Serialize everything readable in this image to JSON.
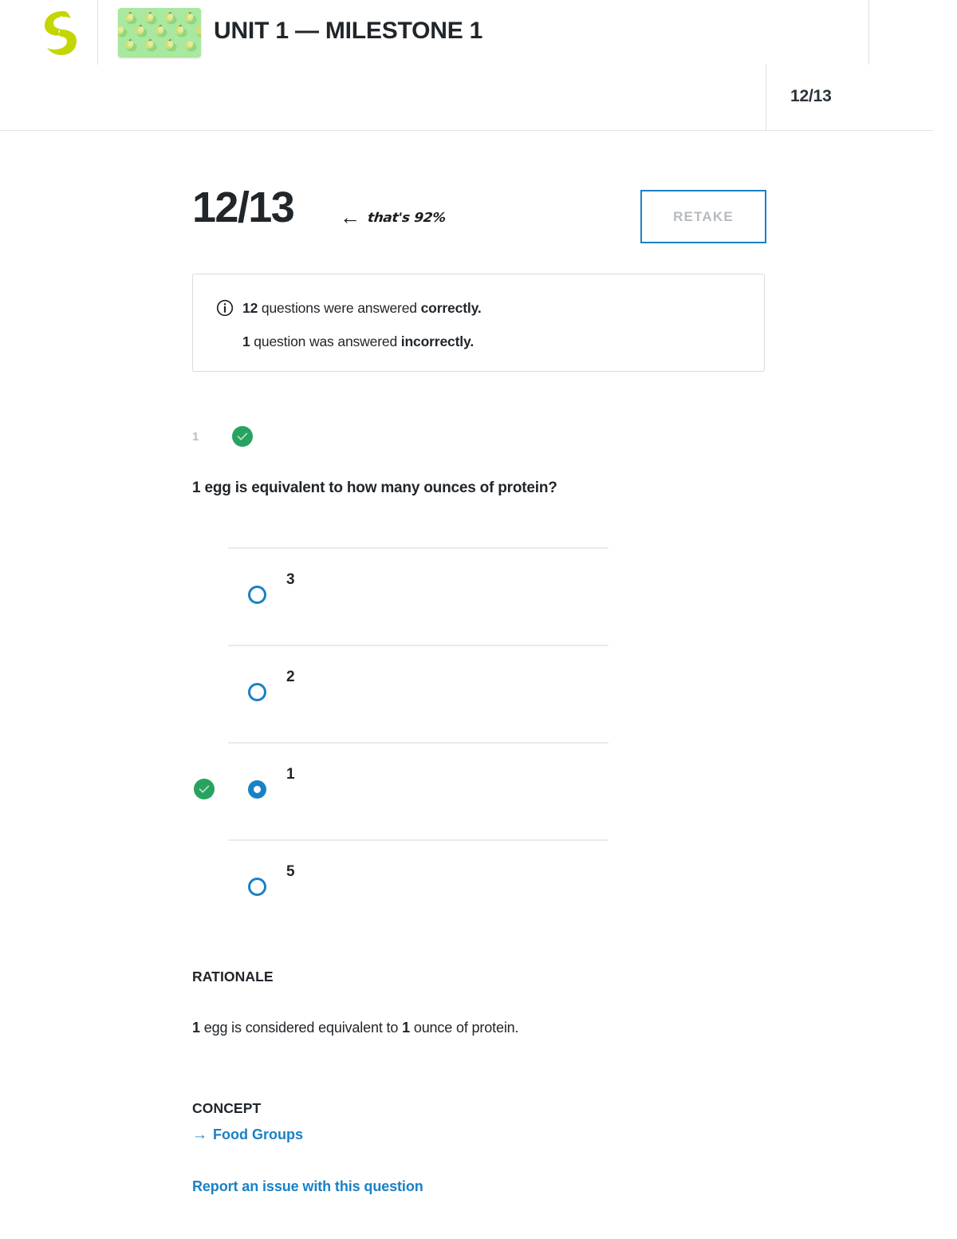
{
  "header": {
    "logo_icon": "sophia-leaf-logo",
    "thumbnail_icon": "green-apples-pattern-thumbnail",
    "title": "UNIT 1 — MILESTONE 1",
    "score": "12/13"
  },
  "score_section": {
    "score": "12/13",
    "annotation_arrow": "←",
    "annotation_text": "that's 92%",
    "retake_label": "RETAKE"
  },
  "info_box": {
    "icon": "info-circle-icon",
    "line1_count": "12",
    "line1_text": " questions were answered ",
    "line1_emphasis": "correctly",
    "line1_end": ".",
    "line2_count": "1",
    "line2_text": " question was answered ",
    "line2_emphasis": "incorrectly",
    "line2_end": "."
  },
  "question": {
    "number": "1",
    "status_icon": "green-check-circle",
    "text": "1 egg is equivalent to how many ounces of protein?",
    "options": [
      {
        "label": "3",
        "selected": false,
        "correct": false
      },
      {
        "label": "2",
        "selected": false,
        "correct": false
      },
      {
        "label": "1",
        "selected": true,
        "correct": true
      },
      {
        "label": "5",
        "selected": false,
        "correct": false
      }
    ],
    "rationale_heading": "RATIONALE",
    "rationale_lead": "1",
    "rationale_mid": " egg is considered equivalent to ",
    "rationale_num": "1",
    "rationale_tail": " ounce of protein.",
    "concept_heading": "CONCEPT",
    "concept_arrow": "→",
    "concept_link": "Food Groups",
    "report_link": "Report an issue with this question"
  },
  "colors": {
    "accent_blue": "#1a81c6",
    "correct_green": "#27a35f",
    "logo_green": "#c3d600",
    "text_dark": "#21262b",
    "muted_gray": "#b9bdc1"
  }
}
